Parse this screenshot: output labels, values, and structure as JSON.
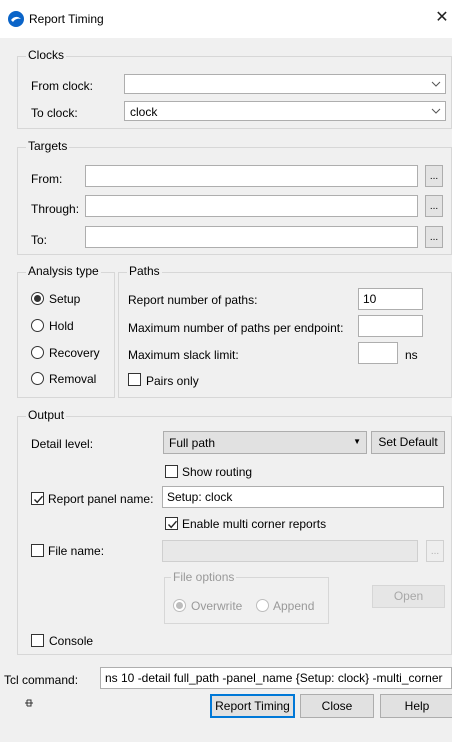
{
  "window": {
    "title": "Report Timing",
    "close_glyph": "✕",
    "icon": "app-logo-icon",
    "accent": "#0078d7"
  },
  "clocks": {
    "group_label": "Clocks",
    "from_label": "From clock:",
    "from_value": "",
    "to_label": "To clock:",
    "to_value": "clock"
  },
  "targets": {
    "group_label": "Targets",
    "from_label": "From:",
    "through_label": "Through:",
    "to_label": "To:",
    "from_value": "",
    "through_value": "",
    "to_value": "",
    "browse_glyph": "..."
  },
  "analysis": {
    "group_label": "Analysis type",
    "options": [
      "Setup",
      "Hold",
      "Recovery",
      "Removal"
    ],
    "selected": "Setup"
  },
  "paths": {
    "group_label": "Paths",
    "num_paths_label": "Report number of paths:",
    "num_paths_value": "10",
    "max_per_endpoint_label": "Maximum number of paths per endpoint:",
    "max_per_endpoint_value": "",
    "max_slack_label": "Maximum slack limit:",
    "max_slack_value": "",
    "max_slack_unit": "ns",
    "pairs_only_label": "Pairs only",
    "pairs_only_checked": false
  },
  "output": {
    "group_label": "Output",
    "detail_label": "Detail level:",
    "detail_value": "Full path",
    "detail_arrow": "▼",
    "set_default_label": "Set Default",
    "show_routing_label": "Show routing",
    "show_routing_checked": false,
    "report_panel_label": "Report panel name:",
    "report_panel_checked": true,
    "report_panel_value": "Setup: clock",
    "multi_corner_label": "Enable multi corner reports",
    "multi_corner_checked": true,
    "file_name_label": "File name:",
    "file_name_checked": false,
    "file_name_value": "",
    "file_options_label": "File options",
    "overwrite_label": "Overwrite",
    "append_label": "Append",
    "open_label": "Open",
    "console_label": "Console",
    "console_checked": false
  },
  "tcl": {
    "label": "Tcl command:",
    "value": "ns 10 -detail full_path -panel_name {Setup: clock} -multi_corner"
  },
  "footer": {
    "pin_icon": "pin-icon",
    "report_timing_label": "Report Timing",
    "close_label": "Close",
    "help_label": "Help"
  }
}
